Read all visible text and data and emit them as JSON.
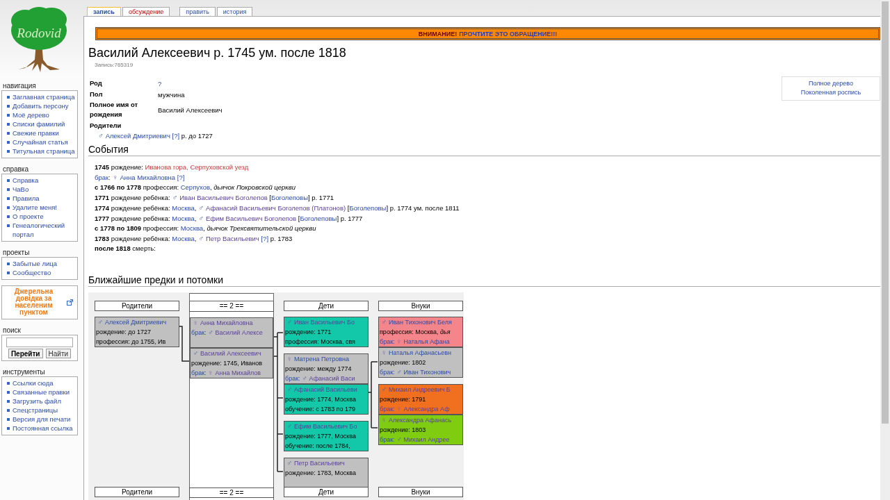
{
  "logo": {
    "text": "Rodovid"
  },
  "tab_groups": [
    [
      {
        "label": "запись",
        "selected": true,
        "missing": false
      },
      {
        "label": "обсуждение",
        "selected": false,
        "missing": true
      }
    ],
    [
      {
        "label": "править",
        "selected": false,
        "missing": false
      },
      {
        "label": "история",
        "selected": false,
        "missing": false
      }
    ]
  ],
  "sidebar": [
    {
      "kind": "list",
      "title": "навигация",
      "items": [
        "Заглавная страница",
        "Добавить персону",
        "Моё дерево",
        "Списки фамилий",
        "Свежие правки",
        "Случайная статья",
        "Титульная страница"
      ]
    },
    {
      "kind": "list",
      "title": "справка",
      "items": [
        "Справка",
        "ЧаВо",
        "Правила",
        "Удалите меня!",
        "О проекте",
        "Генеалогический портал"
      ]
    },
    {
      "kind": "list",
      "title": "проекты",
      "items": [
        "Забытые лица",
        "Сообщество"
      ]
    },
    {
      "kind": "promo",
      "text": "Джерельна довідка за населеним пунктом"
    },
    {
      "kind": "search",
      "title": "поиск",
      "buttons": [
        "Перейти",
        "Найти"
      ]
    },
    {
      "kind": "list",
      "title": "инструменты",
      "items": [
        "Ссылки сюда",
        "Связанные правки",
        "Загрузить файл",
        "Спецстраницы",
        "Версия для печати",
        "Постоянная ссылка"
      ]
    }
  ],
  "notice": {
    "label": "ВНИМАНИЕ!",
    "link": "ПРОЧТИТЕ ЭТО ОБРАЩЕНИЕ!!!"
  },
  "title": "Василий Алексеевич р. 1745 ум. после 1818",
  "record_id": "Запись:765319",
  "side_links": [
    "Полное дерево",
    "Поколенная роспись"
  ],
  "infobox": [
    {
      "label": "Род",
      "link": "?"
    },
    {
      "label": "Пол",
      "value": "мужчина"
    },
    {
      "label": "Полное имя от рождения",
      "value": "Василий Алексеевич"
    }
  ],
  "parents": {
    "label": "Родители",
    "line": [
      {
        "kind": "male",
        "text": "♂"
      },
      {
        "kind": "link",
        "text": "Алексей Дмитриевич"
      },
      {
        "kind": "ref",
        "text": "[?]"
      },
      {
        "kind": "plain",
        "text": " р. до 1727"
      }
    ]
  },
  "events_heading": "События",
  "events": [
    [
      {
        "kind": "bold",
        "text": "1745 "
      },
      {
        "kind": "plain",
        "text": "рождение: "
      },
      {
        "kind": "red",
        "text": "Иванова гора, Серпуховской уезд"
      }
    ],
    [
      {
        "kind": "link",
        "text": "брак:"
      },
      {
        "kind": "female",
        "text": "♀"
      },
      {
        "kind": "link",
        "text": "Анна Михайловна"
      },
      {
        "kind": "ref",
        "text": "[?]"
      }
    ],
    [
      {
        "kind": "bold",
        "text": "с 1766 по 1778 "
      },
      {
        "kind": "plain",
        "text": "профессия: "
      },
      {
        "kind": "link",
        "text": "Серпухов"
      },
      {
        "kind": "plain",
        "text": ", "
      },
      {
        "kind": "italic",
        "text": "дьячок Покровской церкви"
      }
    ],
    [
      {
        "kind": "bold",
        "text": "1771 "
      },
      {
        "kind": "plain",
        "text": "рождение ребёнка:"
      },
      {
        "kind": "male",
        "text": "♂"
      },
      {
        "kind": "visited",
        "text": "Иван Васильевич Боголепов"
      },
      {
        "kind": "plain",
        "text": " ["
      },
      {
        "kind": "link",
        "text": "Боголеповы"
      },
      {
        "kind": "plain",
        "text": "] р. 1771"
      }
    ],
    [
      {
        "kind": "bold",
        "text": "1774 "
      },
      {
        "kind": "plain",
        "text": "рождение ребёнка: "
      },
      {
        "kind": "link",
        "text": "Москва"
      },
      {
        "kind": "plain",
        "text": ","
      },
      {
        "kind": "male",
        "text": "♂"
      },
      {
        "kind": "visited",
        "text": "Афанасий Васильевич Боголепов (Платонов)"
      },
      {
        "kind": "plain",
        "text": " ["
      },
      {
        "kind": "link",
        "text": "Боголеповы"
      },
      {
        "kind": "plain",
        "text": "] р. 1774 ум. после 1811"
      }
    ],
    [
      {
        "kind": "bold",
        "text": "1777 "
      },
      {
        "kind": "plain",
        "text": "рождение ребёнка: "
      },
      {
        "kind": "link",
        "text": "Москва"
      },
      {
        "kind": "plain",
        "text": ","
      },
      {
        "kind": "male",
        "text": "♂"
      },
      {
        "kind": "visited",
        "text": "Ефим Васильевич Боголепов"
      },
      {
        "kind": "plain",
        "text": " ["
      },
      {
        "kind": "link",
        "text": "Боголеповы"
      },
      {
        "kind": "plain",
        "text": "] р. 1777"
      }
    ],
    [
      {
        "kind": "bold",
        "text": "с 1778 по 1809 "
      },
      {
        "kind": "plain",
        "text": "профессия: "
      },
      {
        "kind": "link",
        "text": "Москва"
      },
      {
        "kind": "plain",
        "text": ", "
      },
      {
        "kind": "italic",
        "text": "дьячок Трехсвятительской церкви"
      }
    ],
    [
      {
        "kind": "bold",
        "text": "1783 "
      },
      {
        "kind": "plain",
        "text": "рождение ребёнка: "
      },
      {
        "kind": "link",
        "text": "Москва"
      },
      {
        "kind": "plain",
        "text": ","
      },
      {
        "kind": "male",
        "text": "♂"
      },
      {
        "kind": "visited",
        "text": "Петр Васильевич"
      },
      {
        "kind": "ref",
        "text": "[?]"
      },
      {
        "kind": "plain",
        "text": " р. 1783"
      }
    ],
    [
      {
        "kind": "bold",
        "text": "после 1818 "
      },
      {
        "kind": "plain",
        "text": "смерть:"
      }
    ]
  ],
  "tree_heading": "Ближайшие предки и потомки",
  "tree": [
    {
      "header": "Родители",
      "footer": "Родители",
      "panel": false,
      "groups": [
        [
          {
            "color": "#c0c0c0",
            "lines": [
              [
                {
                  "kind": "male",
                  "text": "♂"
                },
                {
                  "kind": "link",
                  "text": "Алексей Дмитриевич"
                }
              ],
              [
                {
                  "kind": "plain",
                  "text": "рождение: до 1727"
                }
              ],
              [
                {
                  "kind": "plain",
                  "text": "профессия: до 1755, Ив"
                }
              ]
            ]
          }
        ]
      ]
    },
    {
      "header": "== 2 ==",
      "footer": "== 2 ==",
      "panel": true,
      "groups": [
        [
          {
            "color": "#c0c0c0",
            "lines": [
              [
                {
                  "kind": "female",
                  "text": "♀"
                },
                {
                  "kind": "visited",
                  "text": "Анна Михайловна"
                }
              ],
              [
                {
                  "kind": "link",
                  "text": "брак:"
                },
                {
                  "kind": "male",
                  "text": "♂"
                },
                {
                  "kind": "visited",
                  "text": "Василий Алексе"
                }
              ]
            ]
          },
          {
            "color": "#c0c0c0",
            "lines": [
              [
                {
                  "kind": "male",
                  "text": "♂"
                },
                {
                  "kind": "visited",
                  "text": "Василий Алексеевич"
                }
              ],
              [
                {
                  "kind": "plain",
                  "text": "рождение: 1745, Иванов"
                }
              ],
              [
                {
                  "kind": "link",
                  "text": "брак:"
                },
                {
                  "kind": "female",
                  "text": "♀"
                },
                {
                  "kind": "visited",
                  "text": "Анна Михайлов"
                }
              ]
            ]
          }
        ]
      ]
    },
    {
      "header": "Дети",
      "footer": "Дети",
      "panel": false,
      "groups": [
        [
          {
            "color": "#13c8a8",
            "lines": [
              [
                {
                  "kind": "male",
                  "text": "♂"
                },
                {
                  "kind": "visited",
                  "text": "Иван Васильевич Бо"
                }
              ],
              [
                {
                  "kind": "plain",
                  "text": "рождение: 1771"
                }
              ],
              [
                {
                  "kind": "plain",
                  "text": "профессия: Москва, свя"
                }
              ]
            ]
          }
        ],
        [
          {
            "color": "#c0c0c0",
            "lines": [
              [
                {
                  "kind": "female",
                  "text": "♀"
                },
                {
                  "kind": "link",
                  "text": "Матрена Петровна"
                }
              ],
              [
                {
                  "kind": "plain",
                  "text": "рождение: между 1774"
                }
              ],
              [
                {
                  "kind": "link",
                  "text": "брак:"
                },
                {
                  "kind": "male",
                  "text": "♂"
                },
                {
                  "kind": "visited",
                  "text": "Афанасий Васи"
                }
              ]
            ]
          },
          {
            "color": "#13c8a8",
            "lines": [
              [
                {
                  "kind": "male",
                  "text": "♂"
                },
                {
                  "kind": "visited",
                  "text": "Афанасий Васильеви"
                }
              ],
              [
                {
                  "kind": "plain",
                  "text": "рождение: 1774, Москва"
                }
              ],
              [
                {
                  "kind": "plain",
                  "text": "обучение: с 1783 по 179"
                }
              ]
            ]
          }
        ],
        [
          {
            "color": "#13c8a8",
            "lines": [
              [
                {
                  "kind": "male",
                  "text": "♂"
                },
                {
                  "kind": "visited",
                  "text": "Ефим Васильевич Бо"
                }
              ],
              [
                {
                  "kind": "plain",
                  "text": "рождение: 1777, Москва"
                }
              ],
              [
                {
                  "kind": "plain",
                  "text": "обучение: после 1784,"
                }
              ]
            ]
          }
        ],
        [
          {
            "color": "#c0c0c0",
            "lines": [
              [
                {
                  "kind": "male",
                  "text": "♂"
                },
                {
                  "kind": "visited",
                  "text": "Петр Васильевич"
                }
              ],
              [
                {
                  "kind": "plain",
                  "text": "рождение: 1783, Москва"
                }
              ]
            ]
          }
        ]
      ]
    },
    {
      "header": "Внуки",
      "footer": "Внуки",
      "panel": false,
      "groups": [
        [
          {
            "color": "#f4858a",
            "lines": [
              [
                {
                  "kind": "male",
                  "text": "♂"
                },
                {
                  "kind": "link",
                  "text": "Иван Тихонович Беля"
                }
              ],
              [
                {
                  "kind": "plain",
                  "text": "профессия: Москва, "
                },
                {
                  "kind": "italic",
                  "text": "дья"
                }
              ],
              [
                {
                  "kind": "link",
                  "text": "брак:"
                },
                {
                  "kind": "female",
                  "text": "♀"
                },
                {
                  "kind": "link",
                  "text": "Наталья Афана"
                }
              ]
            ]
          },
          {
            "color": "#c0c0c0",
            "lines": [
              [
                {
                  "kind": "female",
                  "text": "♀"
                },
                {
                  "kind": "link",
                  "text": "Наталья Афанасьевн"
                }
              ],
              [
                {
                  "kind": "plain",
                  "text": "рождение: 1802"
                }
              ],
              [
                {
                  "kind": "link",
                  "text": "брак:"
                },
                {
                  "kind": "male",
                  "text": "♂"
                },
                {
                  "kind": "link",
                  "text": "Иван Тихонович"
                }
              ]
            ]
          }
        ],
        [
          {
            "color": "#f07020",
            "lines": [
              [
                {
                  "kind": "male",
                  "text": "♂"
                },
                {
                  "kind": "visited",
                  "text": "Михаил Андреевич Б"
                }
              ],
              [
                {
                  "kind": "plain",
                  "text": "рождение: 1791"
                }
              ],
              [
                {
                  "kind": "visited",
                  "text": "брак:"
                },
                {
                  "kind": "female",
                  "text": "♀"
                },
                {
                  "kind": "visited",
                  "text": "Александра Аф"
                }
              ]
            ]
          },
          {
            "color": "#80cc10",
            "lines": [
              [
                {
                  "kind": "female",
                  "text": "♀"
                },
                {
                  "kind": "visited",
                  "text": "Александра Афанась"
                }
              ],
              [
                {
                  "kind": "plain",
                  "text": "рождение: 1803"
                }
              ],
              [
                {
                  "kind": "link",
                  "text": "брак:"
                },
                {
                  "kind": "male",
                  "text": "♂"
                },
                {
                  "kind": "visited",
                  "text": "Михаил Андрее"
                }
              ]
            ]
          }
        ]
      ]
    }
  ]
}
